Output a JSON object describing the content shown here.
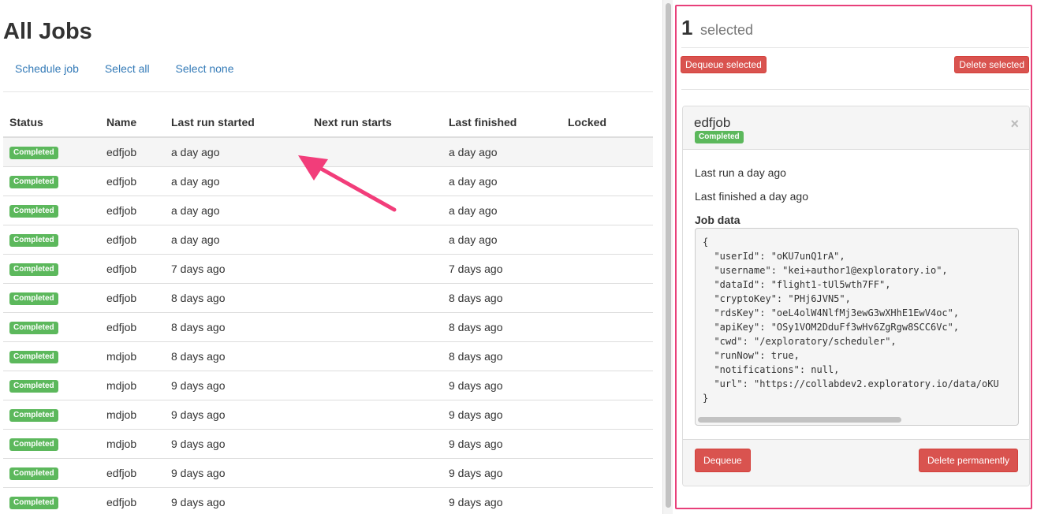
{
  "page": {
    "title": "All Jobs",
    "actions": [
      "Schedule job",
      "Select all",
      "Select none"
    ]
  },
  "table": {
    "columns": [
      "Status",
      "Name",
      "Last run started",
      "Next run starts",
      "Last finished",
      "Locked"
    ],
    "rows": [
      {
        "status": "Completed",
        "name": "edfjob",
        "last_run": "a day ago",
        "next_run": "",
        "last_finished": "a day ago",
        "locked": ""
      },
      {
        "status": "Completed",
        "name": "edfjob",
        "last_run": "a day ago",
        "next_run": "",
        "last_finished": "a day ago",
        "locked": ""
      },
      {
        "status": "Completed",
        "name": "edfjob",
        "last_run": "a day ago",
        "next_run": "",
        "last_finished": "a day ago",
        "locked": ""
      },
      {
        "status": "Completed",
        "name": "edfjob",
        "last_run": "a day ago",
        "next_run": "",
        "last_finished": "a day ago",
        "locked": ""
      },
      {
        "status": "Completed",
        "name": "edfjob",
        "last_run": "7 days ago",
        "next_run": "",
        "last_finished": "7 days ago",
        "locked": ""
      },
      {
        "status": "Completed",
        "name": "edfjob",
        "last_run": "8 days ago",
        "next_run": "",
        "last_finished": "8 days ago",
        "locked": ""
      },
      {
        "status": "Completed",
        "name": "edfjob",
        "last_run": "8 days ago",
        "next_run": "",
        "last_finished": "8 days ago",
        "locked": ""
      },
      {
        "status": "Completed",
        "name": "mdjob",
        "last_run": "8 days ago",
        "next_run": "",
        "last_finished": "8 days ago",
        "locked": ""
      },
      {
        "status": "Completed",
        "name": "mdjob",
        "last_run": "9 days ago",
        "next_run": "",
        "last_finished": "9 days ago",
        "locked": ""
      },
      {
        "status": "Completed",
        "name": "mdjob",
        "last_run": "9 days ago",
        "next_run": "",
        "last_finished": "9 days ago",
        "locked": ""
      },
      {
        "status": "Completed",
        "name": "mdjob",
        "last_run": "9 days ago",
        "next_run": "",
        "last_finished": "9 days ago",
        "locked": ""
      },
      {
        "status": "Completed",
        "name": "edfjob",
        "last_run": "9 days ago",
        "next_run": "",
        "last_finished": "9 days ago",
        "locked": ""
      },
      {
        "status": "Completed",
        "name": "edfjob",
        "last_run": "9 days ago",
        "next_run": "",
        "last_finished": "9 days ago",
        "locked": ""
      }
    ]
  },
  "selection": {
    "count": "1",
    "label": "selected",
    "dequeue_selected": "Dequeue selected",
    "delete_selected": "Delete selected"
  },
  "detail": {
    "name": "edfjob",
    "status": "Completed",
    "last_run": "Last run a day ago",
    "last_finished": "Last finished a day ago",
    "job_data_label": "Job data",
    "job_data_lines": [
      "{",
      "  \"userId\": \"oKU7unQ1rA\",",
      "  \"username\": \"kei+author1@exploratory.io\",",
      "  \"dataId\": \"flight1-tUl5wth7FF\",",
      "  \"cryptoKey\": \"PHj6JVN5\",",
      "  \"rdsKey\": \"oeL4olW4NlfMj3ewG3wXHhE1EwV4oc\",",
      "  \"apiKey\": \"OSy1VOM2DduFf3wHv6ZgRgw8SCC6Vc\",",
      "  \"cwd\": \"/exploratory/scheduler\",",
      "  \"runNow\": true,",
      "  \"notifications\": null,",
      "  \"url\": \"https://collabdev2.exploratory.io/data/oKU",
      "}"
    ],
    "dequeue": "Dequeue",
    "delete_permanently": "Delete permanently",
    "close": "×"
  },
  "colors": {
    "completed_badge": "#5cb85c",
    "danger": "#d9534f",
    "link": "#337ab7",
    "highlight_border": "#e8407a",
    "arrow": "#f23d7a"
  }
}
